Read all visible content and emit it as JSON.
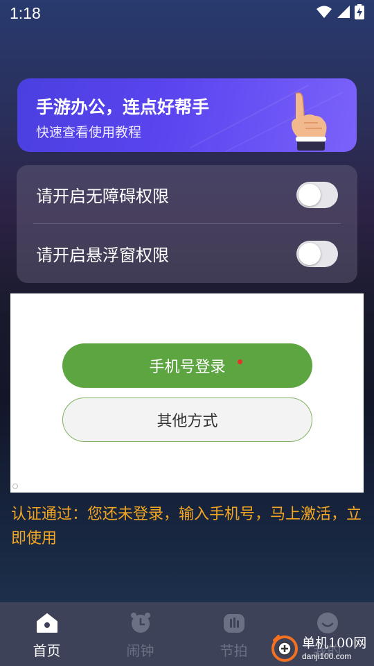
{
  "status_bar": {
    "time": "1:18",
    "icons": [
      "wifi-icon",
      "signal-icon",
      "battery-charging-icon"
    ]
  },
  "banner": {
    "title": "手游办公，连点好帮手",
    "subtitle": "快速查看使用教程",
    "icon": "pointing-hand-icon"
  },
  "permissions": [
    {
      "label": "请开启无障碍权限",
      "enabled": false
    },
    {
      "label": "请开启悬浮窗权限",
      "enabled": false
    }
  ],
  "login": {
    "phone_button": "手机号登录",
    "other_button": "其他方式",
    "phone_accent": "#5da541"
  },
  "notice": "认证通过：您还未登录，输入手机号，马上激活，立即使用",
  "bottom_nav": [
    {
      "label": "首页",
      "icon": "home-icon",
      "active": true
    },
    {
      "label": "闹钟",
      "icon": "alarm-clock-icon",
      "active": false
    },
    {
      "label": "节拍",
      "icon": "metronome-icon",
      "active": false
    },
    {
      "label": "我的",
      "icon": "profile-icon",
      "active": false
    }
  ],
  "watermark": {
    "main": "单机100网",
    "sub": "danji100.com"
  },
  "colors": {
    "notice": "#f2a623",
    "banner_start": "#4b3fe0",
    "banner_end": "#7b62fb",
    "nav_bg": "#3d4259"
  }
}
